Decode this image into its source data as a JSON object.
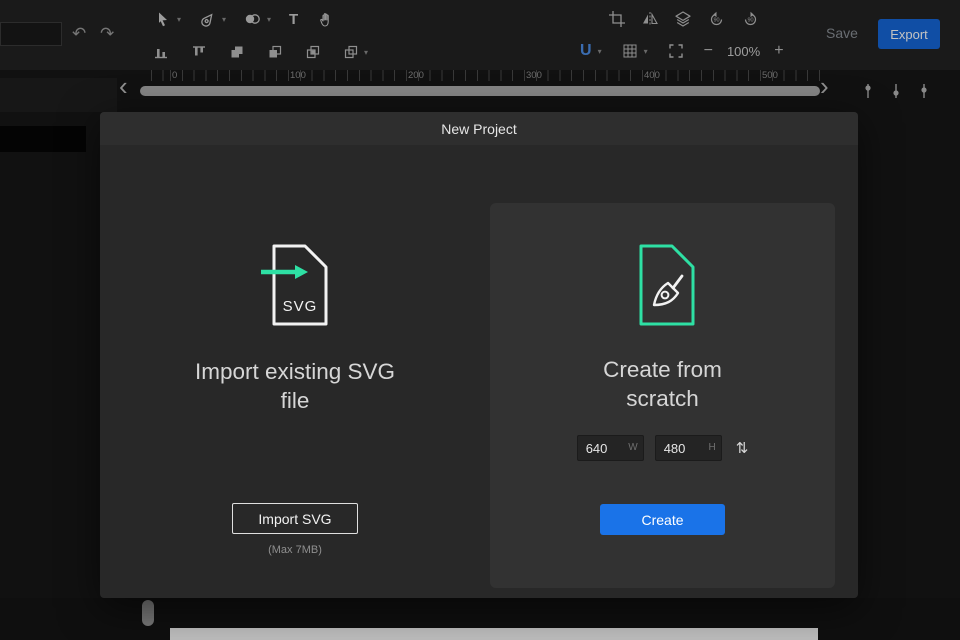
{
  "toolbar": {
    "save_label": "Save",
    "export_label": "Export",
    "zoom_level": "100%",
    "text_tool_label": "T",
    "snap_label": "U",
    "rotate_label": "90"
  },
  "ruler": {
    "ticks": [
      "0",
      "100",
      "200",
      "300",
      "400",
      "500"
    ]
  },
  "icons": {
    "undo": "↶",
    "redo": "↷",
    "chevron_left": "‹",
    "chevron_right": "›",
    "caret": "▾",
    "minus": "−",
    "plus": "+",
    "swap": "⇅"
  },
  "modal": {
    "title": "New Project",
    "import": {
      "heading": "Import existing SVG file",
      "icon_label": "SVG",
      "button": "Import SVG",
      "note": "(Max 7MB)"
    },
    "create": {
      "heading": "Create from scratch",
      "width_value": "640",
      "width_suffix": "W",
      "height_value": "480",
      "height_suffix": "H",
      "button": "Create"
    }
  },
  "colors": {
    "accent_green": "#2ee0a4",
    "accent_blue": "#1a73e8"
  }
}
